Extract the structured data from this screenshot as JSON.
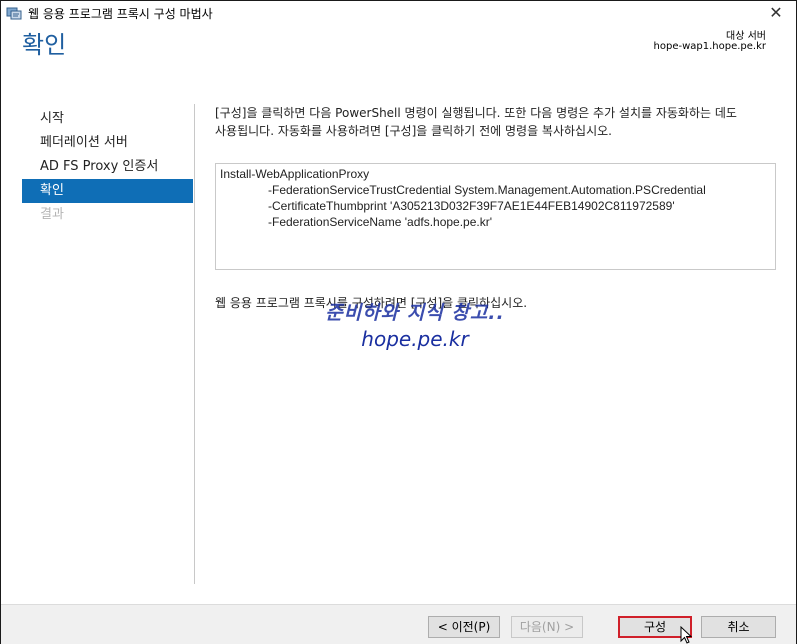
{
  "window": {
    "title": "웹 응용 프로그램 프록시 구성 마법사",
    "close_label": "✕"
  },
  "header": {
    "page_title": "확인",
    "destination_label": "대상 서버",
    "destination_value": "hope-wap1.hope.pe.kr"
  },
  "nav": {
    "items": [
      {
        "label": "시작",
        "state": "normal"
      },
      {
        "label": "페더레이션 서버",
        "state": "normal"
      },
      {
        "label": "AD FS Proxy 인증서",
        "state": "normal"
      },
      {
        "label": "확인",
        "state": "active"
      },
      {
        "label": "결과",
        "state": "disabled"
      }
    ]
  },
  "main": {
    "intro_line1": "[구성]을 클릭하면 다음 PowerShell 명령이 실행됩니다. 또한 다음 명령은 추가 설치를 자동화하는 데도",
    "intro_line2": "사용됩니다. 자동화를 사용하려면 [구성]을 클릭하기 전에 명령을 복사하십시오.",
    "command_lines": [
      "Install-WebApplicationProxy",
      "-FederationServiceTrustCredential System.Management.Automation.PSCredential",
      "-CertificateThumbprint 'A305213D032F39F7AE1E44FEB14902C811972589'",
      "-FederationServiceName 'adfs.hope.pe.kr'"
    ],
    "footer_note": "웹 응용 프로그램 프록시를 구성하려면 [구성]을 클릭하십시오."
  },
  "watermark": {
    "line1": "준비하와 지식 창고..",
    "line2": "hope.pe.kr"
  },
  "buttons": {
    "prev": "< 이전(P)",
    "next": "다음(N) >",
    "configure": "구성",
    "cancel": "취소"
  },
  "colors": {
    "accent": "#0f6eb6",
    "heading": "#1f5fa0",
    "highlight_border": "#d0202a"
  }
}
